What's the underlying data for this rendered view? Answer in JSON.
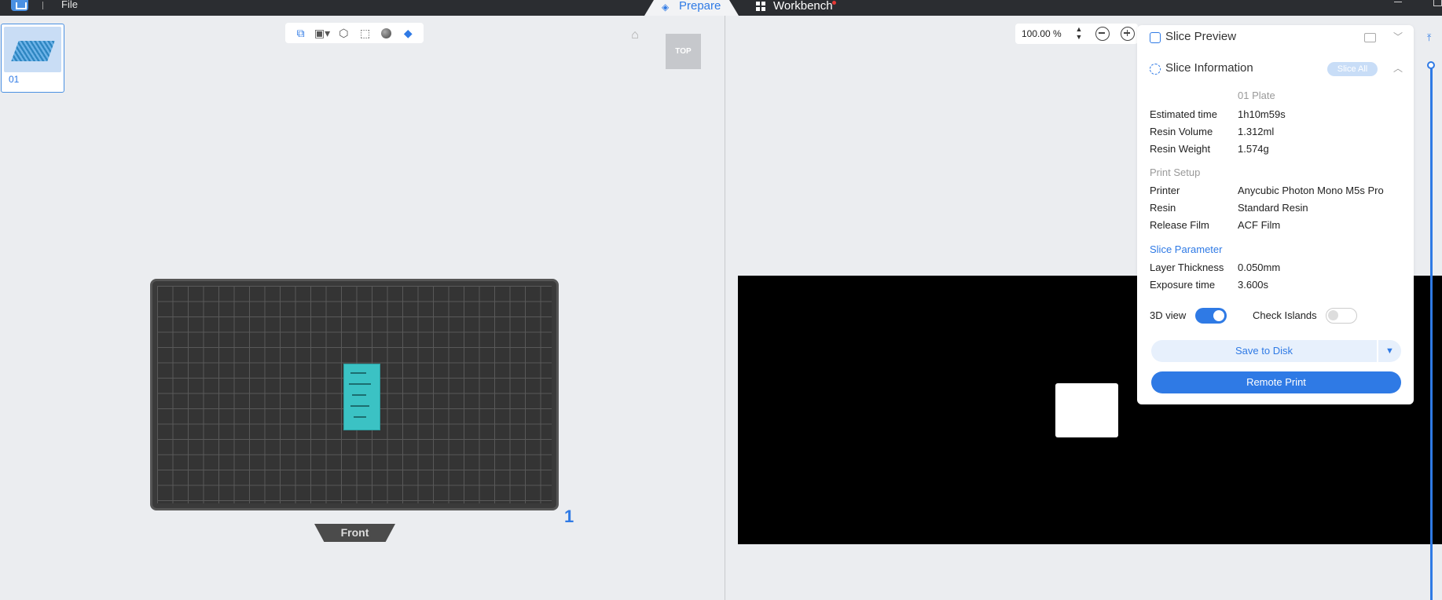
{
  "menu": {
    "file_label": "File"
  },
  "tabs": [
    {
      "label": "Prepare",
      "active": true
    },
    {
      "label": "Workbench",
      "active": false
    }
  ],
  "plate_list": [
    {
      "label": "01"
    }
  ],
  "view_toolbar": {
    "icons": [
      "perspective-icon",
      "cube-menu-icon",
      "lock-view-icon",
      "select-icon",
      "render-sphere-icon",
      "layer-cube-icon"
    ]
  },
  "view_cube": {
    "label": "TOP"
  },
  "build_plate": {
    "front_label": "Front",
    "plate_number": "1"
  },
  "zoom": {
    "value": "100.00 %"
  },
  "slice_preview": {
    "title": "Slice Preview",
    "info": {
      "title": "Slice Information",
      "slice_all_label": "Slice All",
      "plate_label": "01 Plate",
      "rows": [
        {
          "k": "Estimated time",
          "v": "1h10m59s"
        },
        {
          "k": "Resin Volume",
          "v": "1.312ml"
        },
        {
          "k": "Resin Weight",
          "v": "1.574g"
        }
      ],
      "print_setup_label": "Print Setup",
      "setup_rows": [
        {
          "k": "Printer",
          "v": "Anycubic Photon Mono M5s Pro"
        },
        {
          "k": "Resin",
          "v": "Standard Resin"
        },
        {
          "k": "Release Film",
          "v": "ACF Film"
        }
      ],
      "slice_param_label": "Slice Parameter",
      "param_rows": [
        {
          "k": "Layer Thickness",
          "v": "0.050mm"
        },
        {
          "k": "Exposure time",
          "v": "3.600s"
        }
      ]
    },
    "toggles": {
      "view3d_label": "3D view",
      "view3d_on": true,
      "islands_label": "Check Islands",
      "islands_on": false
    },
    "save_label": "Save to Disk",
    "remote_label": "Remote Print"
  },
  "colors": {
    "accent": "#2f7ae5",
    "topbar": "#2b2d31",
    "slice_bg": "#000000"
  }
}
